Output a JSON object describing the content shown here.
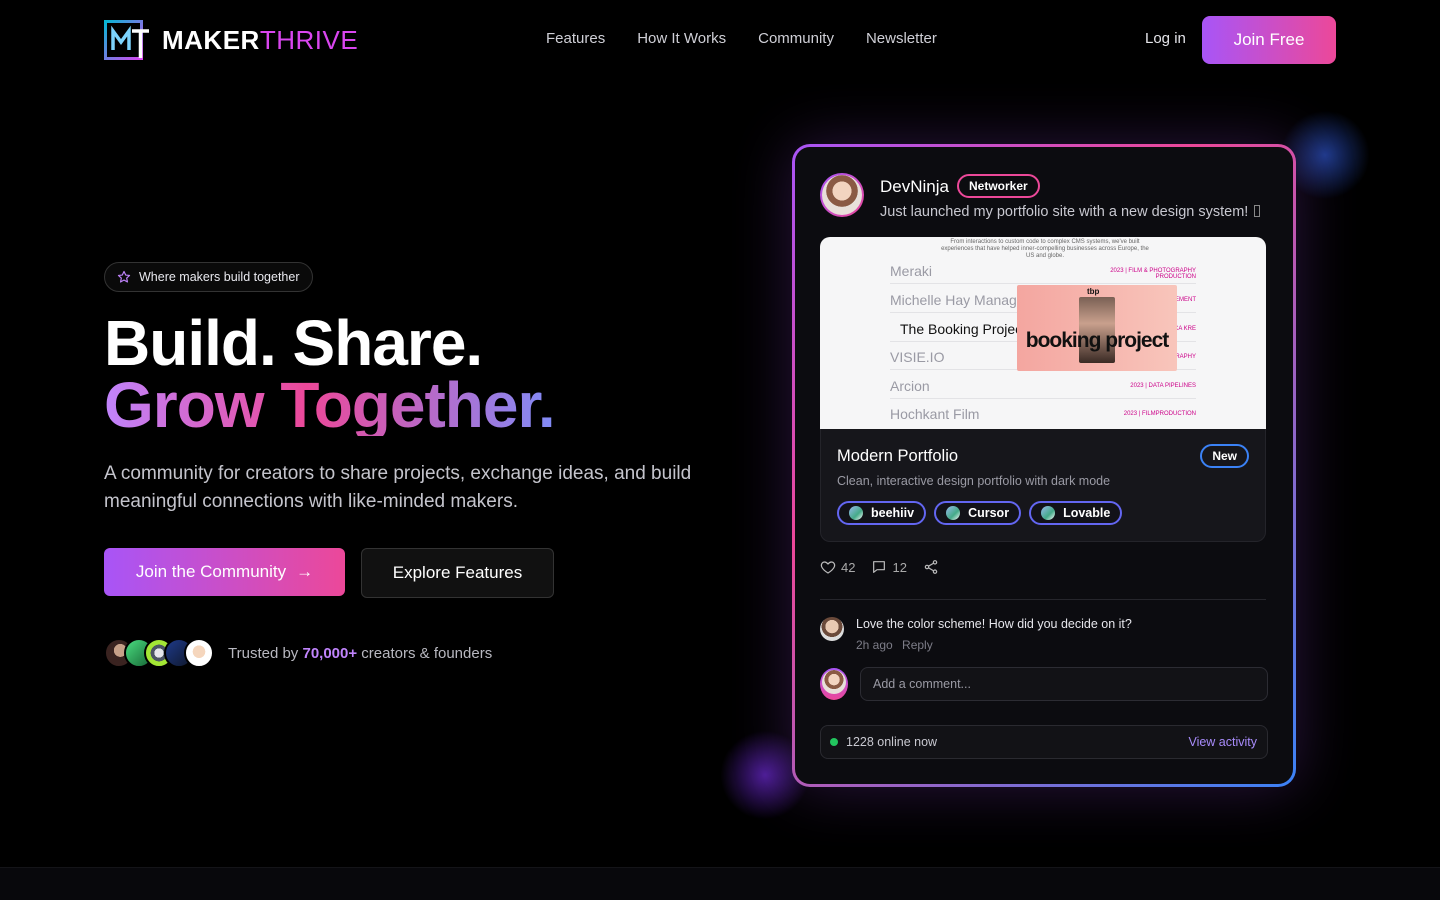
{
  "brand": {
    "name_a": "MAKER",
    "name_b": "THRIVE"
  },
  "nav": {
    "items": [
      "Features",
      "How It Works",
      "Community",
      "Newsletter"
    ],
    "login": "Log in",
    "join": "Join Free"
  },
  "hero": {
    "pill": "Where makers build together",
    "line1": "Build. Share.",
    "line2": "Grow Together.",
    "subtitle": "A community for creators to share projects, exchange ideas, and build meaningful connections with like-minded makers.",
    "cta_primary": "Join the Community",
    "cta_secondary": "Explore Features",
    "trust_prefix": "Trusted by",
    "trust_count": "70,000+",
    "trust_suffix": "creators & founders"
  },
  "post": {
    "user": "DevNinja",
    "badge": "Networker",
    "text": "Just launched my portfolio site with a new design system! ",
    "shot": {
      "header": "From interactions to custom code to complex CMS systems, we've built experiences that have helped inner-compelling businesses across Europe, the US and globe.",
      "rows": [
        "Meraki",
        "Michelle Hay Manag",
        "The Booking Projec",
        "VISIE.IO",
        "Arcion",
        "Hochkant Film"
      ],
      "row_tags": [
        "2023 | FILM & PHOTOGRAPHY PRODUCTION",
        "EMENT",
        "ICA KRE",
        "GRAPHY",
        "2023 | DATA PIPELINES",
        "2023 | FILMPRODUCTION"
      ],
      "thumb_brand": "tbp",
      "thumb_title": "booking project"
    },
    "project_title": "Modern Portfolio",
    "project_badge": "New",
    "project_desc": "Clean, interactive design portfolio with dark mode",
    "tags": [
      "beehiiv",
      "Cursor",
      "Lovable"
    ],
    "likes": "42",
    "comments": "12"
  },
  "comment": {
    "text": "Love the color scheme! How did you decide on it?",
    "time": "2h ago",
    "reply": "Reply"
  },
  "composer": {
    "placeholder": "Add a comment..."
  },
  "status": {
    "online": "1228 online now",
    "link": "View activity"
  },
  "colors": {
    "accent_purple": "#a855f7",
    "accent_pink": "#ec4899",
    "accent_blue": "#3b82f6",
    "online": "#22c55e"
  }
}
